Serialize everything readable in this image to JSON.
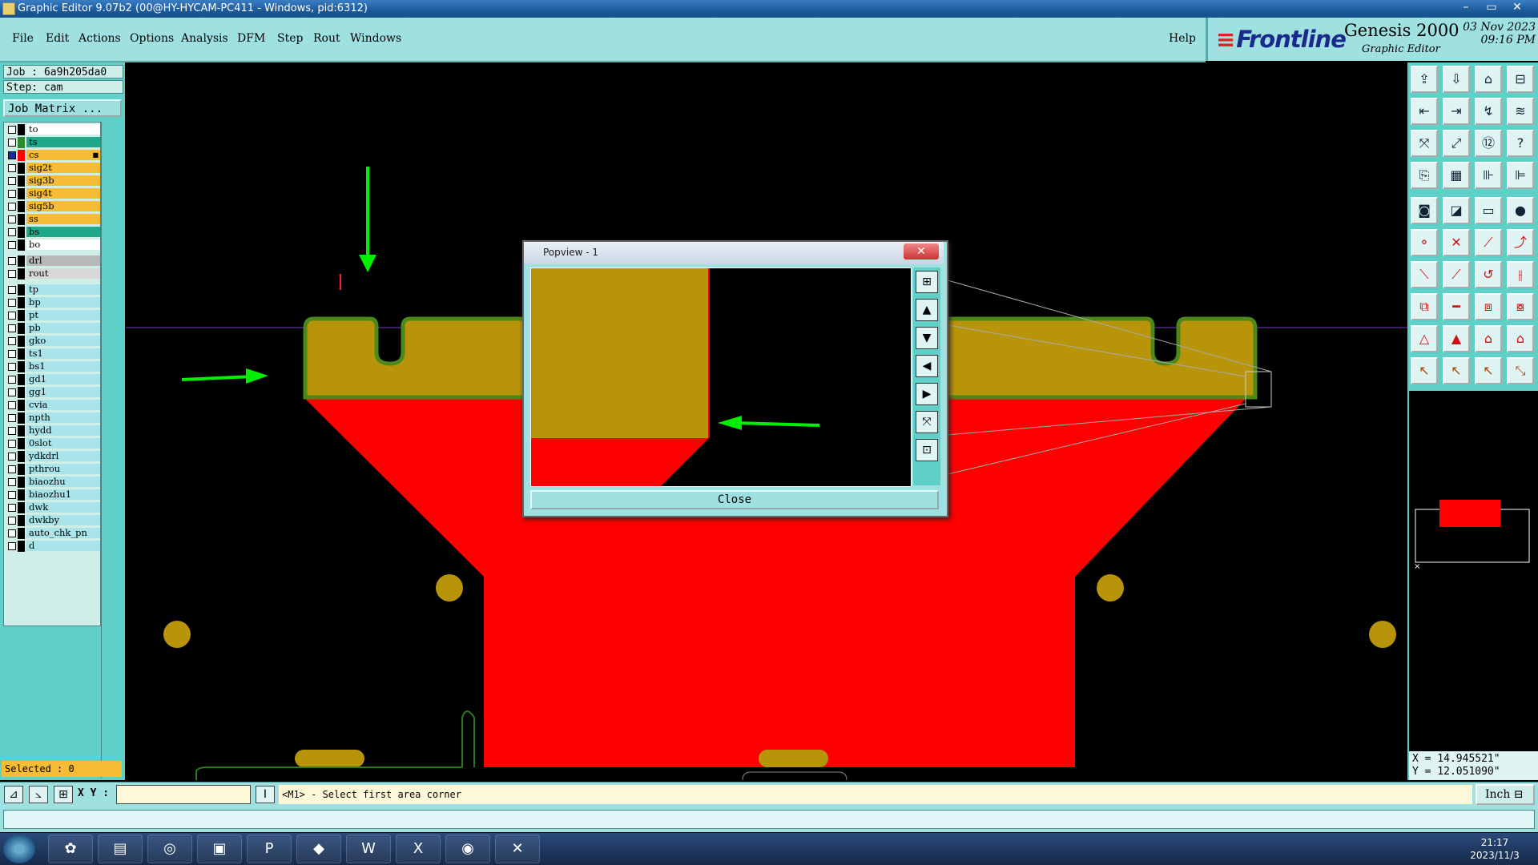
{
  "window": {
    "title": "Graphic Editor 9.07b2 (00@HY-HYCAM-PC411 - Windows, pid:6312)",
    "controls": [
      "–",
      "▭",
      "✕"
    ]
  },
  "menu": [
    "File",
    "Edit",
    "Actions",
    "Options",
    "Analysis",
    "DFM",
    "Step",
    "Rout",
    "Windows"
  ],
  "help_label": "Help",
  "brand": {
    "logo": "Frontline",
    "product": "Genesis 2000",
    "subtitle": "Graphic Editor",
    "date": "03  Nov  2023",
    "time": "09:16 PM"
  },
  "left_panel": {
    "job": "Job : 6a9h205da0",
    "step": "Step: cam",
    "job_matrix": "Job Matrix ...",
    "selected": "Selected : 0",
    "layers": [
      {
        "name": "to",
        "color": "#ffffff",
        "swatch": "#000000",
        "checked": false
      },
      {
        "name": "ts",
        "color": "#1fa88a",
        "swatch": "#2e8b2e",
        "checked": false
      },
      {
        "name": "cs",
        "color": "#f5bc34",
        "swatch": "#ff0000",
        "checked": true,
        "marker": "■"
      },
      {
        "name": "sig2t",
        "color": "#f5bc34",
        "swatch": "#000000",
        "checked": false
      },
      {
        "name": "sig3b",
        "color": "#f5bc34",
        "swatch": "#000000",
        "checked": false
      },
      {
        "name": "sig4t",
        "color": "#f5bc34",
        "swatch": "#000000",
        "checked": false
      },
      {
        "name": "sig5b",
        "color": "#f5bc34",
        "swatch": "#000000",
        "checked": false
      },
      {
        "name": "ss",
        "color": "#f5bc34",
        "swatch": "#000000",
        "checked": false
      },
      {
        "name": "bs",
        "color": "#1fa88a",
        "swatch": "#000000",
        "checked": false
      },
      {
        "name": "bo",
        "color": "#ffffff",
        "swatch": "#000000",
        "checked": false
      },
      {
        "name": "drl",
        "color": "#b8b8b8",
        "swatch": "#000000",
        "checked": false
      },
      {
        "name": "rout",
        "color": "#d8d8d8",
        "swatch": "#000000",
        "checked": false
      },
      {
        "name": "tp",
        "color": "#a9e4ea",
        "swatch": "#000000",
        "checked": false
      },
      {
        "name": "bp",
        "color": "#a9e4ea",
        "swatch": "#000000",
        "checked": false
      },
      {
        "name": "pt",
        "color": "#a9e4ea",
        "swatch": "#000000",
        "checked": false
      },
      {
        "name": "pb",
        "color": "#a9e4ea",
        "swatch": "#000000",
        "checked": false
      },
      {
        "name": "gko",
        "color": "#a9e4ea",
        "swatch": "#000000",
        "checked": false
      },
      {
        "name": "ts1",
        "color": "#a9e4ea",
        "swatch": "#000000",
        "checked": false
      },
      {
        "name": "bs1",
        "color": "#a9e4ea",
        "swatch": "#000000",
        "checked": false
      },
      {
        "name": "gd1",
        "color": "#a9e4ea",
        "swatch": "#000000",
        "checked": false
      },
      {
        "name": "gg1",
        "color": "#a9e4ea",
        "swatch": "#000000",
        "checked": false
      },
      {
        "name": "cvia",
        "color": "#a9e4ea",
        "swatch": "#000000",
        "checked": false
      },
      {
        "name": "npth",
        "color": "#a9e4ea",
        "swatch": "#000000",
        "checked": false
      },
      {
        "name": "hydd",
        "color": "#a9e4ea",
        "swatch": "#000000",
        "checked": false
      },
      {
        "name": "0slot",
        "color": "#a9e4ea",
        "swatch": "#000000",
        "checked": false
      },
      {
        "name": "ydkdrl",
        "color": "#a9e4ea",
        "swatch": "#000000",
        "checked": false
      },
      {
        "name": "pthrou",
        "color": "#a9e4ea",
        "swatch": "#000000",
        "checked": false
      },
      {
        "name": "biaozhu",
        "color": "#a9e4ea",
        "swatch": "#000000",
        "checked": false
      },
      {
        "name": "biaozhu1",
        "color": "#a9e4ea",
        "swatch": "#000000",
        "checked": false
      },
      {
        "name": "dwk",
        "color": "#a9e4ea",
        "swatch": "#000000",
        "checked": false
      },
      {
        "name": "dwkby",
        "color": "#a9e4ea",
        "swatch": "#000000",
        "checked": false
      },
      {
        "name": "auto_chk_pn",
        "color": "#a9e4ea",
        "swatch": "#000000",
        "checked": false
      },
      {
        "name": "d",
        "color": "#a9e4ea",
        "swatch": "#000000",
        "checked": false
      }
    ]
  },
  "popview": {
    "title": "Popview - 1",
    "close_label": "Close"
  },
  "coords": {
    "x": "X = 14.945521\"",
    "y": "Y = 12.051090\""
  },
  "status": {
    "xy_label": "X Y :",
    "xy_value": "",
    "prompt": "<M1> - Select first area corner",
    "unit": "Inch"
  },
  "taskbar": {
    "time": "21:17",
    "date": "2023/11/3"
  },
  "colors": {
    "copper": "#b8940a",
    "fill_red": "#ff0000",
    "outline_green": "#4b8a1a",
    "arrow_green": "#00ee00",
    "panel_teal": "#5fd0c8",
    "menu_teal": "#9fe0e0"
  }
}
